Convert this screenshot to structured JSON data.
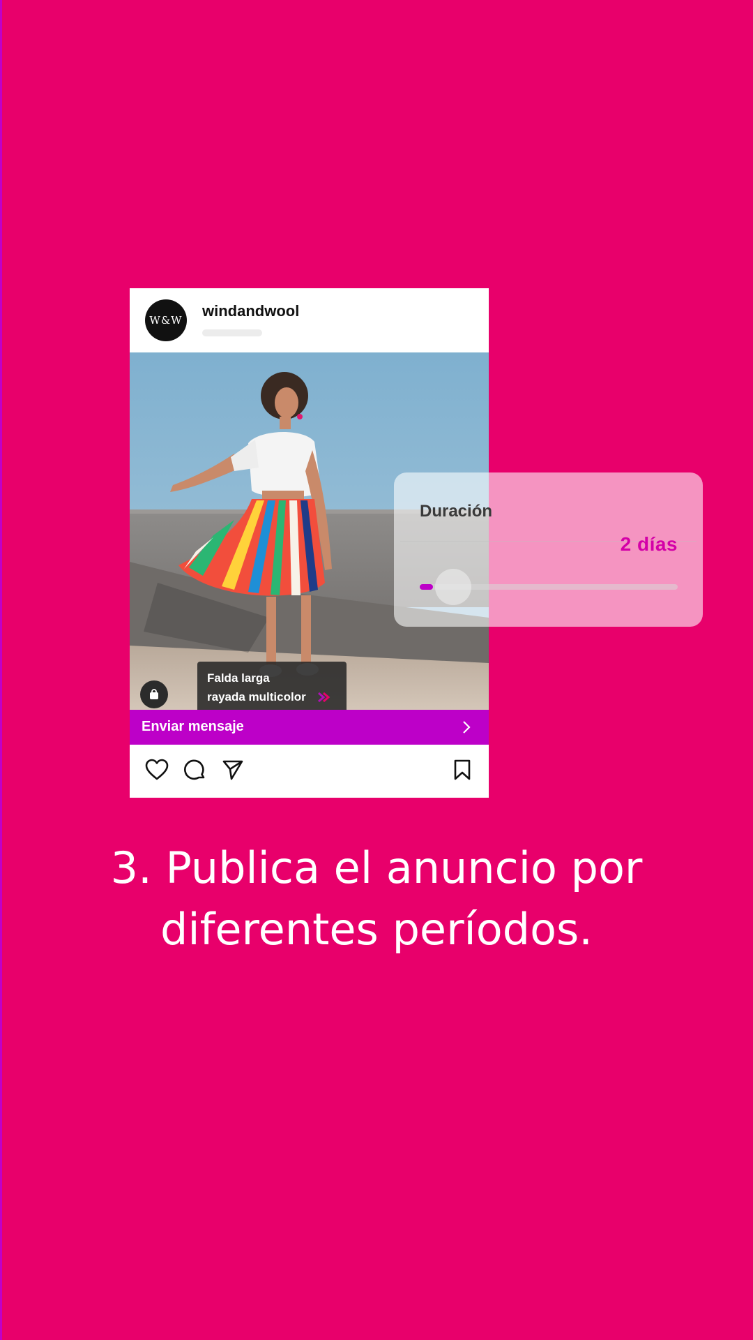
{
  "colors": {
    "background": "#E8006B",
    "accent": "#BD00C8",
    "duration_value": "#D400A8"
  },
  "post": {
    "avatar_text": "W&W",
    "username": "windandwool",
    "product_tag": {
      "line1": "Falda larga",
      "line2": "rayada multicolor",
      "icon": "double-chevron-right-icon"
    },
    "shop_icon": "shopping-bag-icon",
    "cta_label": "Enviar mensaje",
    "cta_icon": "chevron-right-icon",
    "actions": [
      "heart-icon",
      "comment-icon",
      "share-icon",
      "bookmark-icon"
    ]
  },
  "duration": {
    "label": "Duración",
    "value": "2 días",
    "slider_fraction": 0.05
  },
  "caption": {
    "line1": "3. Publica el anuncio por",
    "line2": "diferentes períodos."
  }
}
